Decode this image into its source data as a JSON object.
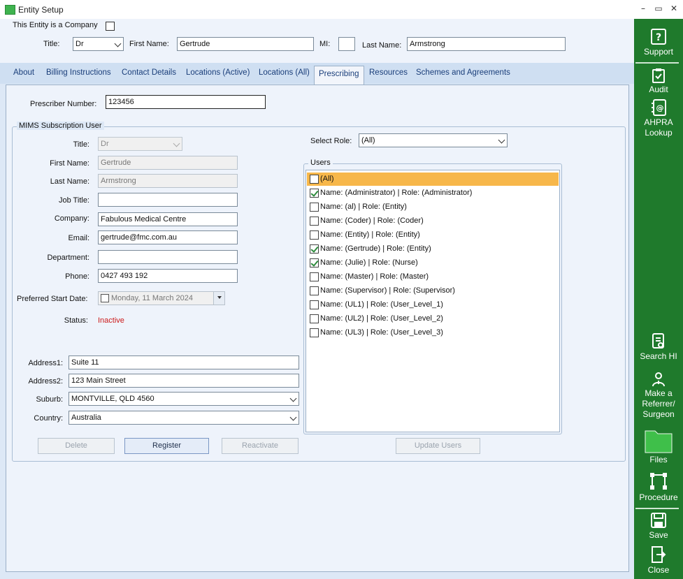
{
  "window": {
    "title": "Entity Setup"
  },
  "header": {
    "company_label": "This Entity is a Company",
    "title_label": "Title:",
    "title_value": "Dr",
    "first_name_label": "First Name:",
    "first_name_value": "Gertrude",
    "mi_label": "MI:",
    "mi_value": "",
    "last_name_label": "Last Name:",
    "last_name_value": "Armstrong"
  },
  "tabs": [
    {
      "label": "About"
    },
    {
      "label": "Billing Instructions"
    },
    {
      "label": "Contact Details"
    },
    {
      "label": "Locations (Active)"
    },
    {
      "label": "Locations (All)"
    },
    {
      "label": "Prescribing"
    },
    {
      "label": "Resources"
    },
    {
      "label": "Schemes and Agreements"
    }
  ],
  "prescribing": {
    "prescriber_label": "Prescriber Number:",
    "prescriber_value": "123456",
    "mims": {
      "group_title": "MIMS Subscription User",
      "title_label": "Title:",
      "title_value": "Dr",
      "first_name_label": "First Name:",
      "first_name_value": "Gertrude",
      "last_name_label": "Last Name:",
      "last_name_value": "Armstrong",
      "job_title_label": "Job Title:",
      "job_title_value": "",
      "company_label": "Company:",
      "company_value": "Fabulous Medical Centre",
      "email_label": "Email:",
      "email_value": "gertrude@fmc.com.au",
      "department_label": "Department:",
      "department_value": "",
      "phone_label": "Phone:",
      "phone_value": "0427 493 192",
      "start_date_label": "Preferred Start Date:",
      "start_date_value": "Monday, 11 March 2024",
      "status_label": "Status:",
      "status_value": "Inactive",
      "address1_label": "Address1:",
      "address1_value": "Suite 11",
      "address2_label": "Address2:",
      "address2_value": "123 Main Street",
      "suburb_label": "Suburb:",
      "suburb_value": "MONTVILLE, QLD 4560",
      "country_label": "Country:",
      "country_value": "Australia"
    },
    "role": {
      "label": "Select Role:",
      "value": "(All)"
    },
    "users_title": "Users",
    "users": [
      {
        "label": "(All)",
        "checked": false
      },
      {
        "label": "Name: (Administrator) | Role: (Administrator)",
        "checked": true
      },
      {
        "label": "Name: (al) | Role: (Entity)",
        "checked": false
      },
      {
        "label": "Name: (Coder) | Role: (Coder)",
        "checked": false
      },
      {
        "label": "Name: (Entity) | Role: (Entity)",
        "checked": false
      },
      {
        "label": "Name: (Gertrude) | Role: (Entity)",
        "checked": true
      },
      {
        "label": "Name: (Julie) | Role: (Nurse)",
        "checked": true
      },
      {
        "label": "Name: (Master) | Role: (Master)",
        "checked": false
      },
      {
        "label": "Name: (Supervisor) | Role: (Supervisor)",
        "checked": false
      },
      {
        "label": "Name: (UL1) | Role: (User_Level_1)",
        "checked": false
      },
      {
        "label": "Name: (UL2) | Role: (User_Level_2)",
        "checked": false
      },
      {
        "label": "Name: (UL3) | Role: (User_Level_3)",
        "checked": false
      }
    ],
    "buttons": {
      "delete": "Delete",
      "register": "Register",
      "reactivate": "Reactivate",
      "update_users": "Update Users"
    }
  },
  "sidebar": {
    "support": "Support",
    "audit": "Audit",
    "ahpra_line1": "AHPRA",
    "ahpra_line2": "Lookup",
    "search_hi": "Search HI",
    "referrer_line1": "Make a",
    "referrer_line2": "Referrer/",
    "referrer_line3": "Surgeon",
    "files": "Files",
    "procedure": "Procedure",
    "save": "Save",
    "close": "Close"
  },
  "colors": {
    "sidebar": "#1f7a2c",
    "selected_row": "#f7b74a",
    "status_inactive": "#cc1a1a"
  }
}
